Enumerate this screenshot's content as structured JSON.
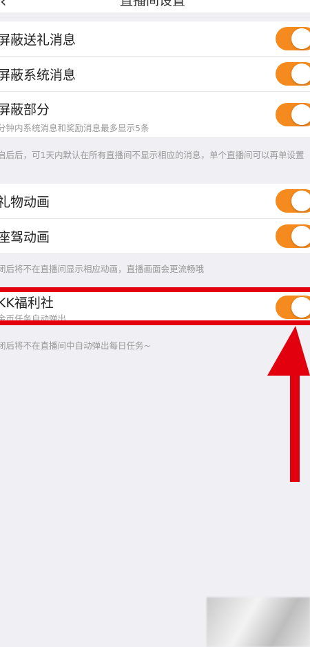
{
  "header": {
    "back_icon": "‹",
    "title": "直播间设置"
  },
  "section1": [
    {
      "label": "屏蔽送礼消息",
      "toggle_on": true
    },
    {
      "label": "屏蔽系统消息",
      "toggle_on": true
    },
    {
      "label": "屏蔽部分",
      "sub": "分钟内系统消息和奖励消息最多显示5条",
      "toggle_on": true
    }
  ],
  "section1_note": "启后后，可1天内默认在所有直播间不显示相应的消息，单个直播间可以再单设置",
  "section2": [
    {
      "label": "礼物动画",
      "toggle_on": true
    },
    {
      "label": "座驾动画",
      "toggle_on": true
    }
  ],
  "section2_note": "闭后将不在直播间显示相应动画，直播画面会更流畅哦",
  "section3": [
    {
      "label": "KK福利社",
      "sub": "金币任务自动弹出",
      "toggle_on": true
    }
  ],
  "section3_note": "闭后将不在直播间中自动弹出每日任务~",
  "annotation": {
    "color": "#e3000e",
    "toggle_color": "#f58b1f"
  }
}
